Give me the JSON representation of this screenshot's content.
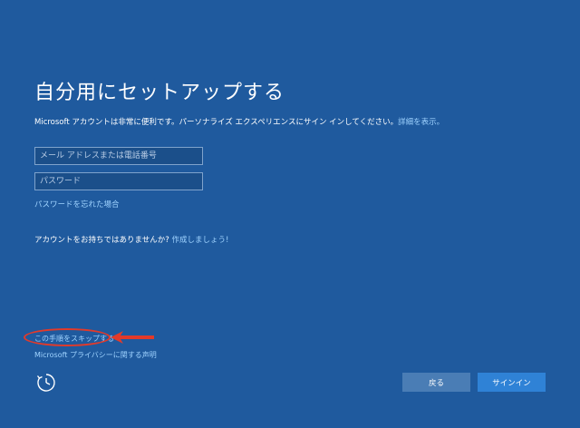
{
  "title": "自分用にセットアップする",
  "description": {
    "text": "Microsoft アカウントは非常に便利です。パーソナライズ エクスペリエンスにサイン インしてください。",
    "link": "詳細を表示。"
  },
  "form": {
    "email_placeholder": "メール アドレスまたは電話番号",
    "password_placeholder": "パスワード",
    "forgot_link": "パスワードを忘れた場合"
  },
  "no_account": {
    "text": "アカウントをお持ちではありませんか?",
    "link": "作成しましょう!"
  },
  "skip_link": "この手順をスキップする",
  "privacy_link": "Microsoft プライバシーに関する声明",
  "buttons": {
    "back": "戻る",
    "signin": "サインイン"
  },
  "colors": {
    "background": "#1f5a9e",
    "link": "#9fd3ff",
    "highlight": "#e23a2a"
  },
  "icons": {
    "accessibility": "accessibility-icon",
    "annotation_arrow": "arrow-left-icon"
  }
}
